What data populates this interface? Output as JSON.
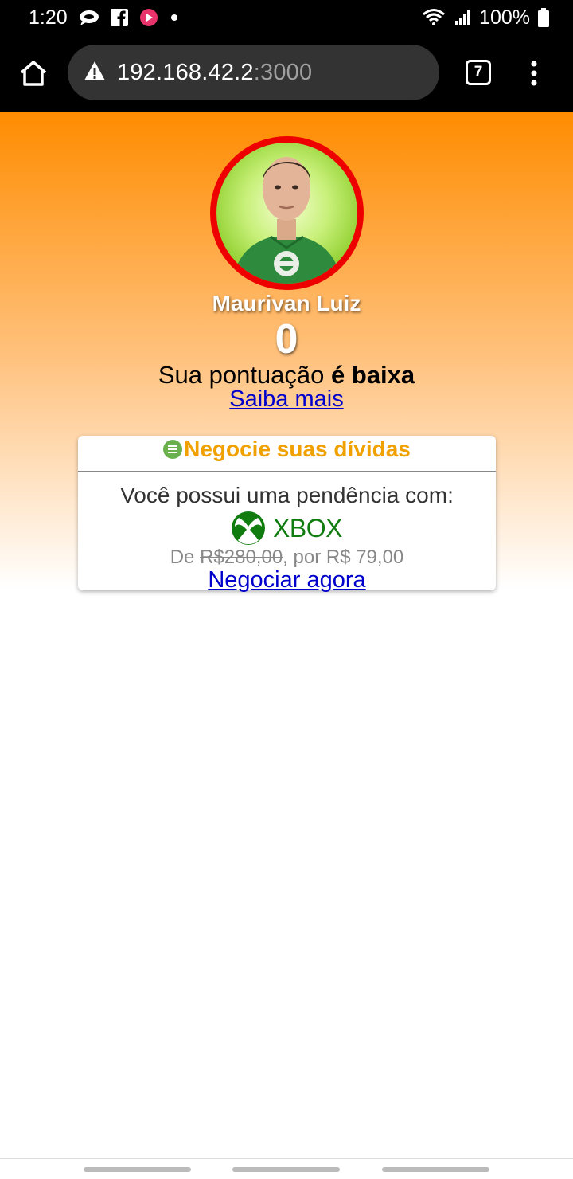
{
  "status_bar": {
    "time": "1:20",
    "battery": "100%",
    "left_icons": [
      "chat-icon",
      "facebook-icon",
      "video-app-icon",
      "dot-icon"
    ],
    "right_icons": [
      "wifi-icon",
      "signal-icon",
      "battery-icon"
    ]
  },
  "browser": {
    "url_host": "192.168.42.2",
    "url_port": ":3000",
    "tab_count": "7",
    "security_icon": "warning-triangle-icon"
  },
  "profile": {
    "name": "Maurivan Luiz",
    "score": "0",
    "status_prefix": "Sua pontuação",
    "status_emphasis": "é baixa",
    "learn_more": "Saiba mais"
  },
  "debt_card": {
    "title": "Negocie suas dívidas",
    "text": "Você possui uma pendência com:",
    "brand": "XBOX",
    "price_prefix": "De",
    "old_price": "R$280,00",
    "price_suffix": ", por R$ 79,00",
    "action": "Negociar agora"
  },
  "colors": {
    "accent_orange": "#ff8c00",
    "title_color": "#f0a100",
    "ring_red": "#ee0000",
    "xbox_green": "#107c10",
    "link_blue": "#0000cc"
  }
}
